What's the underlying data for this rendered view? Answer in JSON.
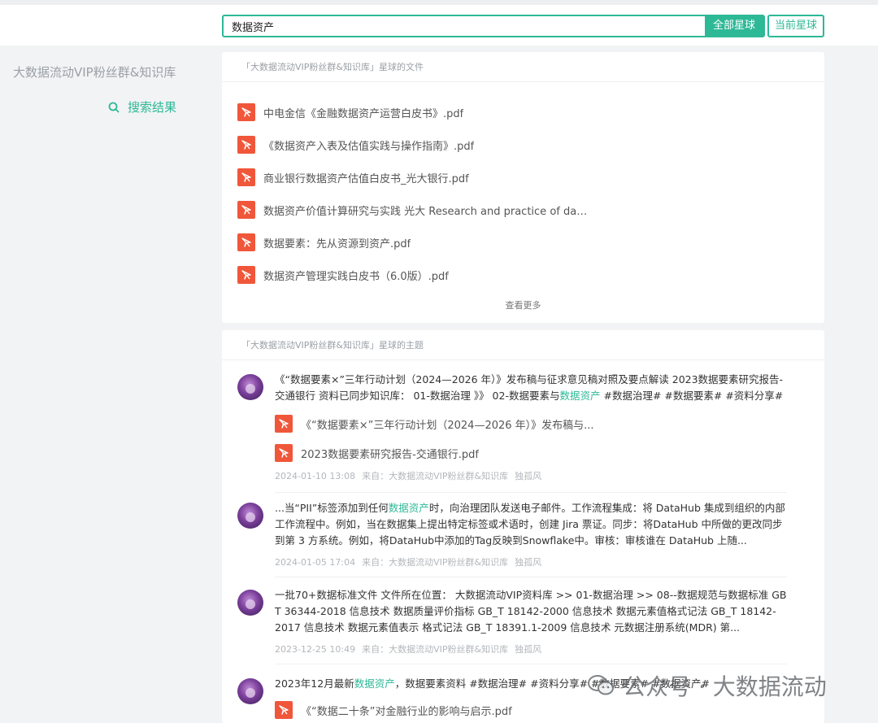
{
  "header": {
    "search_value": "数据资产",
    "btn_all": "全部星球",
    "btn_current": "当前星球"
  },
  "sidebar": {
    "group_title": "大数据流动VIP粉丝群&知识库",
    "search_result": "搜索结果"
  },
  "files_card": {
    "header": "「大数据流动VIP粉丝群&知识库」星球的文件",
    "files": [
      "中电金信《金融数据资产运营白皮书》.pdf",
      "《数据资产入表及估值实践与操作指南》.pdf",
      "商业银行数据资产估值白皮书_光大银行.pdf",
      "数据资产价值计算研究与实践 光大 Research and practice of dat...",
      "数据要素：先从资源到资产.pdf",
      "数据资产管理实践白皮书（6.0版）.pdf"
    ],
    "more": "查看更多"
  },
  "topics_card": {
    "header": "「大数据流动VIP粉丝群&知识库」星球的主题",
    "topics": [
      {
        "text_pre": "《“数据要素×”三年行动计划（2024—2026 年）》发布稿与征求意见稿对照及要点解读 2023数据要素研究报告-交通银行  资料已同步知识库：  01-数据治理 》》 02-数据要素与",
        "text_hl": "数据资产",
        "text_post": "  #数据治理# #数据要素# #资料分享#",
        "attachments": [
          "《“数据要素×”三年行动计划（2024—2026 年）》发布稿与...",
          "2023数据要素研究报告-交通银行.pdf"
        ],
        "time": "2024-01-10 13:08",
        "source": "来自：大数据流动VIP粉丝群&知识库",
        "author": "独孤风"
      },
      {
        "text_pre": "...当“PII”标签添加到任何",
        "text_hl": "数据资产",
        "text_post": "时，向治理团队发送电子邮件。工作流程集成：将 DataHub 集成到组织的内部工作流程中。例如，当在数据集上提出特定标签或术语时，创建 Jira 票证。同步：将DataHub 中所做的更改同步到第 3 方系统。例如，将DataHub中添加的Tag反映到Snowflake中。审核：审核谁在 DataHub 上随...",
        "attachments": [],
        "time": "2024-01-05 17:04",
        "source": "来自：大数据流动VIP粉丝群&知识库",
        "author": "独孤风"
      },
      {
        "text_pre": "一批70+数据标准文件 文件所在位置：  大数据流动VIP资料库 >> 01-数据治理 >> 08--数据规范与数据标准 GB T 36344-2018 信息技术    数据质量评价指标 GB_T 18142-2000 信息技术 数据元素值格式记法 GB_T 18142-2017 信息技术 数据元素值表示 格式记法 GB_T 18391.1-2009 信息技术 元数据注册系统(MDR) 第...",
        "text_hl": "",
        "text_post": "",
        "attachments": [],
        "time": "2023-12-25 10:49",
        "source": "来自：大数据流动VIP粉丝群&知识库",
        "author": "独孤风"
      },
      {
        "text_pre": "2023年12月最新",
        "text_hl": "数据资产",
        "text_post": "，数据要素资料 #数据治理# #资料分享# #数据要素# #数据资产#",
        "attachments": [
          "《“数据二十条”对金融行业的影响与启示.pdf"
        ],
        "time": "",
        "source": "",
        "author": ""
      }
    ]
  },
  "watermark": {
    "text": "公众号 · 大数据流动"
  },
  "colors": {
    "accent": "#2db896",
    "pdf": "#f0573a"
  }
}
